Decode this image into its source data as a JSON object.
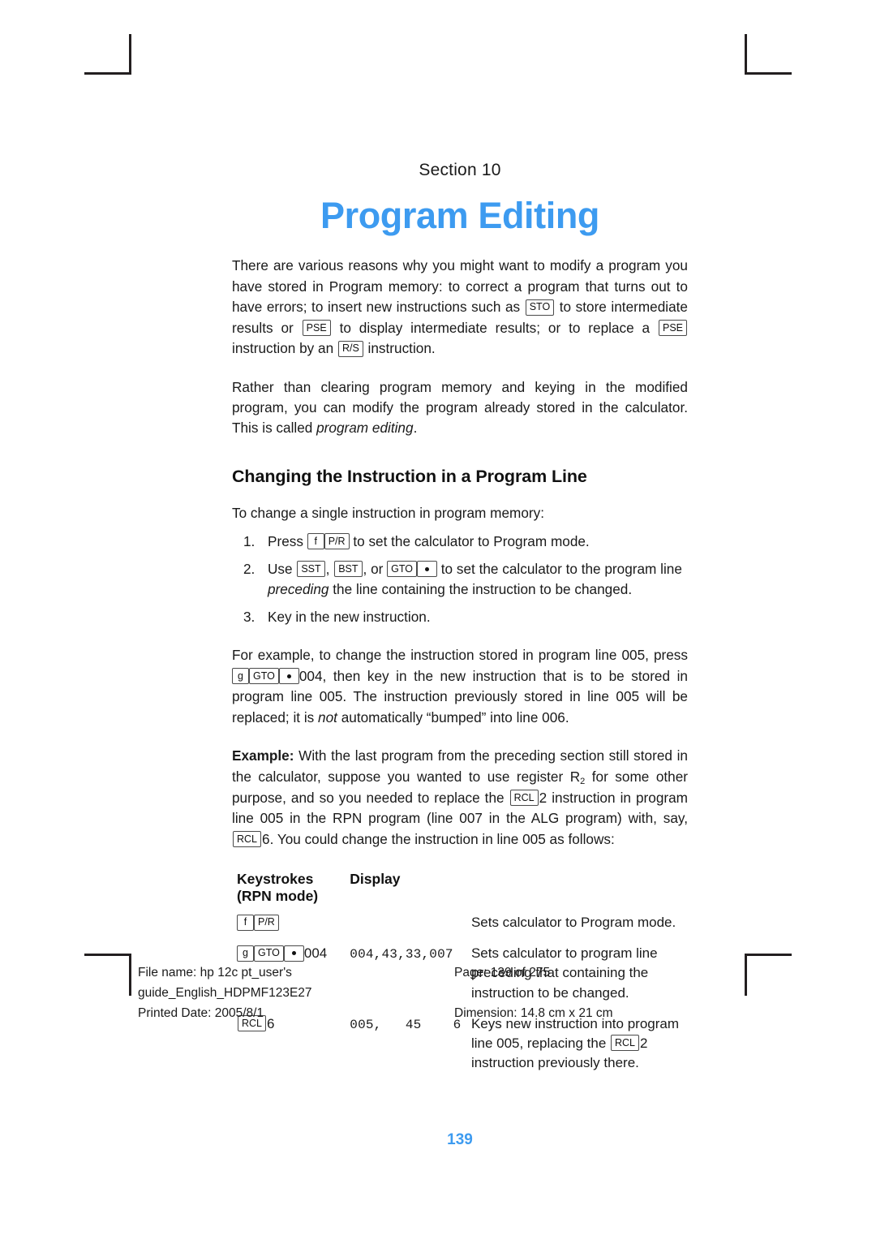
{
  "page": {
    "section_label": "Section  10",
    "chapter_title": "Program Editing",
    "page_number": "139",
    "accent_color": "#3d9bf0"
  },
  "intro": {
    "p1_a": "There are various reasons why you might want to modify a program you have stored in Program memory: to correct a program that turns out to have errors; to insert new instructions such as ",
    "key_sto": "STO",
    "p1_b": " to store intermediate results or ",
    "key_pse1": "PSE",
    "p1_c": " to display intermediate results; or to replace a ",
    "key_pse2": "PSE",
    "p1_d": " instruction by an ",
    "key_rs": "R/S",
    "p1_e": " instruction.",
    "p2_a": "Rather than clearing program memory and keying in the modified program, you can modify the program already stored in the calculator. This is called ",
    "p2_italic": "program editing",
    "p2_b": "."
  },
  "subhead": "Changing the Instruction in a Program Line",
  "lead": "To change a single instruction in program memory:",
  "steps": [
    {
      "num": "1.",
      "a": "Press ",
      "key1": "f",
      "key2": "P/R",
      "b": " to set the calculator to Program mode."
    },
    {
      "num": "2.",
      "a": "Use ",
      "key1": "SST",
      "mid1": ", ",
      "key2": "BST",
      "mid2": ", or ",
      "key3": "GTO",
      "b": " to set the calculator to the program line ",
      "italic": "preceding",
      "c": " the line containing the instruction to be changed."
    },
    {
      "num": "3.",
      "a": "Key in the new instruction."
    }
  ],
  "example_para": {
    "a": "For example, to change the instruction stored in program line 005, press ",
    "key_g": "g",
    "key_gto": "GTO",
    "b": "004, then key in the new instruction that is to be stored in program line 005. The instruction previously stored in line 005 will be replaced; it is ",
    "italic": "not",
    "c": " automatically “bumped” into line 006."
  },
  "example": {
    "label": "Example:",
    "a": " With the last program from the preceding section still stored in the calculator, suppose you wanted to use register R",
    "sub": "2",
    "b": " for some other purpose, and so you needed to replace the ",
    "key_rcl1": "RCL",
    "c": "2 instruction in program line 005 in the RPN program (line 007 in the ALG program) with, say, ",
    "key_rcl2": "RCL",
    "d": "6. You could change the instruction in line 005 as follows:"
  },
  "table": {
    "headers": {
      "keystrokes_line1": "Keystrokes",
      "keystrokes_line2": "(RPN mode)",
      "display": "Display"
    },
    "rows": [
      {
        "keys": [
          {
            "type": "key",
            "label": "f"
          },
          {
            "type": "key",
            "label": "P/R"
          }
        ],
        "keystroke_text": "",
        "display": "",
        "description_a": "Sets calculator to Program mode.",
        "description_b": "",
        "description_c": ""
      },
      {
        "keys": [
          {
            "type": "key",
            "label": "g"
          },
          {
            "type": "key",
            "label": "GTO"
          },
          {
            "type": "dot",
            "label": ""
          }
        ],
        "keystroke_text": "004",
        "display": "004,43,33,007",
        "description_a": "Sets calculator to program line preceding that containing the instruction to be changed.",
        "description_b": "",
        "description_c": ""
      },
      {
        "keys": [
          {
            "type": "key",
            "label": "RCL"
          }
        ],
        "keystroke_text": "6",
        "display": "005,   45    6",
        "description_a": "Keys new instruction into program line 005, replacing the ",
        "key_rcl": "RCL",
        "description_b": "2 instruction previously there.",
        "description_c": ""
      }
    ]
  },
  "footer": {
    "file_name": "File name: hp 12c pt_user's guide_English_HDPMF123E27",
    "page_of": "Page: 139 of 275",
    "printed_date": "Printed Date: 2005/8/1",
    "dimension": "Dimension: 14.8 cm x 21 cm"
  }
}
